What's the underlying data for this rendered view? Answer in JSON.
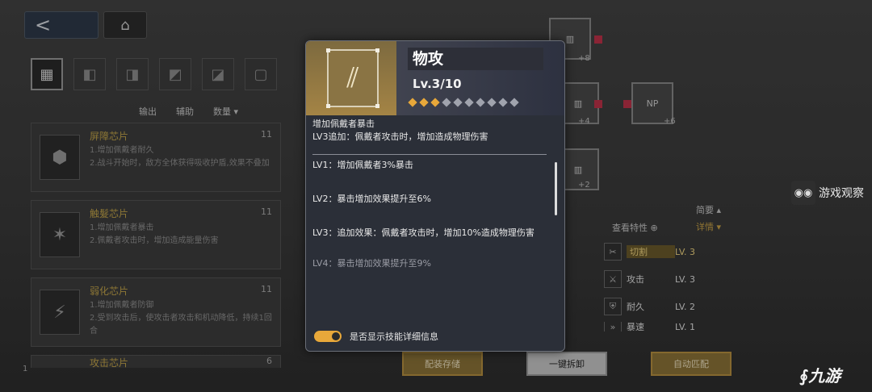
{
  "nav": {
    "back_glyph": "<",
    "home_glyph": "⌂"
  },
  "filters": [
    "all-chip-icon",
    "chip-type-1-icon",
    "chip-type-2-icon",
    "chip-type-3-icon",
    "chip-type-4-icon",
    "chip-type-5-icon"
  ],
  "sort": {
    "output": "输出",
    "support": "辅助",
    "quantity": "数量",
    "arrow": "▾"
  },
  "chips": [
    {
      "name": "屏障芯片",
      "count": "11",
      "desc1": "1.增加佩戴者耐久",
      "desc2": "2.战斗开始时，敌方全体获得吸收护盾,效果不叠加"
    },
    {
      "name": "触髮芯片",
      "count": "11",
      "desc1": "1.增加佩戴者暴击",
      "desc2": "2.佩戴者攻击时，增加造成能量伤害"
    },
    {
      "name": "弱化芯片",
      "count": "11",
      "desc1": "1.增加佩戴者防御",
      "desc2": "2.受到攻击后，使攻击者攻击和机动降低，持续1回合"
    },
    {
      "name": "攻击芯片",
      "count": "6"
    }
  ],
  "popup": {
    "skill_name": "物攻",
    "level": "Lv.3/10",
    "level_current": 3,
    "level_max": 10,
    "body_line1": "增加佩戴者暴击",
    "body_line2": "LV3追加：佩戴者攻击时，增加造成物理伤害",
    "lv_items": [
      "LV1：增加佩戴者3%暴击",
      "LV2：暴击增加效果提升至6%",
      "LV3：追加效果：佩戴者攻击时，增加10%造成物理伤害",
      "LV4：暴击增加效果提升至9%"
    ],
    "toggle_label": "是否显示技能详细信息",
    "toggle_on": true
  },
  "nodes": {
    "n1_badge": "+8",
    "n2_badge": "+4",
    "n3_badge": "+6",
    "n3_label": "NP",
    "n4_badge": "+2"
  },
  "right_panel": {
    "header": "简要 ▴",
    "detail": "详情 ▾",
    "check_traits": "查看特性 ⊕"
  },
  "stats": [
    {
      "name": "切割",
      "lv": "LV. 3",
      "highlight": true
    },
    {
      "name": "攻击",
      "lv": "LV. 3",
      "highlight": false
    },
    {
      "name": "耐久",
      "lv": "LV. 2",
      "highlight": false
    },
    {
      "name": "暴速",
      "lv": "LV. 1",
      "highlight": false
    }
  ],
  "buttons": {
    "save": "配装存储",
    "remove": "一键拆卸",
    "auto": "自动匹配"
  },
  "watermarks": {
    "site": "游戏观察",
    "nine": "九游"
  },
  "page_num": "1",
  "colors": {
    "accent_gold": "#e8a83a",
    "chip_name": "#c4a54a",
    "popup_bg": "#2b2f38"
  }
}
